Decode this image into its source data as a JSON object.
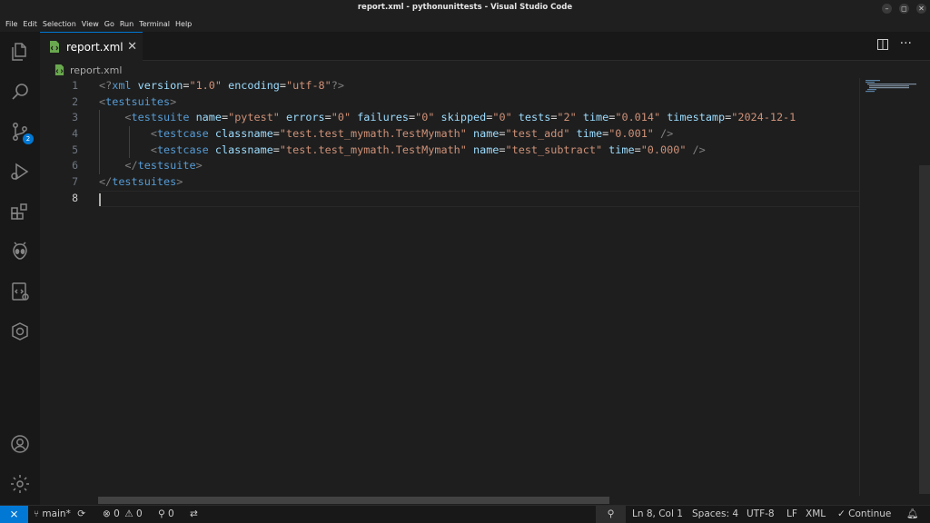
{
  "window": {
    "title": "report.xml - pythonunittests - Visual Studio Code",
    "controls": {
      "minimize": "–",
      "maximize": "◻",
      "close": "✕"
    }
  },
  "menu": [
    "File",
    "Edit",
    "Selection",
    "View",
    "Go",
    "Run",
    "Terminal",
    "Help"
  ],
  "activity_bar": {
    "icons": [
      "explorer-icon",
      "search-icon",
      "source-control-icon",
      "run-debug-icon",
      "extensions-icon",
      "testing-alien-icon",
      "remote-explorer-icon",
      "kubernetes-icon",
      "accounts-icon",
      "settings-gear-icon"
    ],
    "source_control_badge": "2"
  },
  "tab": {
    "label": "report.xml",
    "close": "✕"
  },
  "breadcrumb": {
    "file": "report.xml"
  },
  "editor": {
    "line_numbers": [
      "1",
      "2",
      "3",
      "4",
      "5",
      "6",
      "7",
      "8"
    ],
    "lines": [
      {
        "tokens": [
          {
            "c": "t-punc",
            "t": "<?"
          },
          {
            "c": "t-tag",
            "t": "xml"
          },
          {
            "c": "t-eq",
            "t": " "
          },
          {
            "c": "t-attr",
            "t": "version"
          },
          {
            "c": "t-eq",
            "t": "="
          },
          {
            "c": "t-str",
            "t": "\"1.0\""
          },
          {
            "c": "t-eq",
            "t": " "
          },
          {
            "c": "t-attr",
            "t": "encoding"
          },
          {
            "c": "t-eq",
            "t": "="
          },
          {
            "c": "t-str",
            "t": "\"utf-8\""
          },
          {
            "c": "t-punc",
            "t": "?>"
          }
        ]
      },
      {
        "tokens": [
          {
            "c": "t-punc",
            "t": "<"
          },
          {
            "c": "t-tag",
            "t": "testsuites"
          },
          {
            "c": "t-punc",
            "t": ">"
          }
        ]
      },
      {
        "tokens": [
          {
            "c": "t-eq",
            "t": "    "
          },
          {
            "c": "t-punc",
            "t": "<"
          },
          {
            "c": "t-tag",
            "t": "testsuite"
          },
          {
            "c": "t-eq",
            "t": " "
          },
          {
            "c": "t-attr",
            "t": "name"
          },
          {
            "c": "t-eq",
            "t": "="
          },
          {
            "c": "t-str",
            "t": "\"pytest\""
          },
          {
            "c": "t-eq",
            "t": " "
          },
          {
            "c": "t-attr",
            "t": "errors"
          },
          {
            "c": "t-eq",
            "t": "="
          },
          {
            "c": "t-str",
            "t": "\"0\""
          },
          {
            "c": "t-eq",
            "t": " "
          },
          {
            "c": "t-attr",
            "t": "failures"
          },
          {
            "c": "t-eq",
            "t": "="
          },
          {
            "c": "t-str",
            "t": "\"0\""
          },
          {
            "c": "t-eq",
            "t": " "
          },
          {
            "c": "t-attr",
            "t": "skipped"
          },
          {
            "c": "t-eq",
            "t": "="
          },
          {
            "c": "t-str",
            "t": "\"0\""
          },
          {
            "c": "t-eq",
            "t": " "
          },
          {
            "c": "t-attr",
            "t": "tests"
          },
          {
            "c": "t-eq",
            "t": "="
          },
          {
            "c": "t-str",
            "t": "\"2\""
          },
          {
            "c": "t-eq",
            "t": " "
          },
          {
            "c": "t-attr",
            "t": "time"
          },
          {
            "c": "t-eq",
            "t": "="
          },
          {
            "c": "t-str",
            "t": "\"0.014\""
          },
          {
            "c": "t-eq",
            "t": " "
          },
          {
            "c": "t-attr",
            "t": "timestamp"
          },
          {
            "c": "t-eq",
            "t": "="
          },
          {
            "c": "t-str",
            "t": "\"2024-12-1"
          }
        ]
      },
      {
        "tokens": [
          {
            "c": "t-eq",
            "t": "        "
          },
          {
            "c": "t-punc",
            "t": "<"
          },
          {
            "c": "t-tag",
            "t": "testcase"
          },
          {
            "c": "t-eq",
            "t": " "
          },
          {
            "c": "t-attr",
            "t": "classname"
          },
          {
            "c": "t-eq",
            "t": "="
          },
          {
            "c": "t-str",
            "t": "\"test.test_mymath.TestMymath\""
          },
          {
            "c": "t-eq",
            "t": " "
          },
          {
            "c": "t-attr",
            "t": "name"
          },
          {
            "c": "t-eq",
            "t": "="
          },
          {
            "c": "t-str",
            "t": "\"test_add\""
          },
          {
            "c": "t-eq",
            "t": " "
          },
          {
            "c": "t-attr",
            "t": "time"
          },
          {
            "c": "t-eq",
            "t": "="
          },
          {
            "c": "t-str",
            "t": "\"0.001\""
          },
          {
            "c": "t-eq",
            "t": " "
          },
          {
            "c": "t-punc",
            "t": "/>"
          }
        ]
      },
      {
        "tokens": [
          {
            "c": "t-eq",
            "t": "        "
          },
          {
            "c": "t-punc",
            "t": "<"
          },
          {
            "c": "t-tag",
            "t": "testcase"
          },
          {
            "c": "t-eq",
            "t": " "
          },
          {
            "c": "t-attr",
            "t": "classname"
          },
          {
            "c": "t-eq",
            "t": "="
          },
          {
            "c": "t-str",
            "t": "\"test.test_mymath.TestMymath\""
          },
          {
            "c": "t-eq",
            "t": " "
          },
          {
            "c": "t-attr",
            "t": "name"
          },
          {
            "c": "t-eq",
            "t": "="
          },
          {
            "c": "t-str",
            "t": "\"test_subtract\""
          },
          {
            "c": "t-eq",
            "t": " "
          },
          {
            "c": "t-attr",
            "t": "time"
          },
          {
            "c": "t-eq",
            "t": "="
          },
          {
            "c": "t-str",
            "t": "\"0.000\""
          },
          {
            "c": "t-eq",
            "t": " "
          },
          {
            "c": "t-punc",
            "t": "/>"
          }
        ]
      },
      {
        "tokens": [
          {
            "c": "t-eq",
            "t": "    "
          },
          {
            "c": "t-punc",
            "t": "</"
          },
          {
            "c": "t-tag",
            "t": "testsuite"
          },
          {
            "c": "t-punc",
            "t": ">"
          }
        ]
      },
      {
        "tokens": [
          {
            "c": "t-punc",
            "t": "</"
          },
          {
            "c": "t-tag",
            "t": "testsuites"
          },
          {
            "c": "t-punc",
            "t": ">"
          }
        ]
      },
      {
        "tokens": []
      }
    ]
  },
  "status_bar": {
    "remote_icon": "remote-icon",
    "branch": "main*",
    "errors": "0",
    "warnings": "0",
    "ports": "0",
    "cursor_position": "Ln 8, Col 1",
    "indentation": "Spaces: 4",
    "encoding": "UTF-8",
    "eol": "LF",
    "language": "XML",
    "continue": "Continue"
  },
  "colors": {
    "accent": "#0078d4",
    "tag": "#569cd6",
    "attribute": "#9cdcfe",
    "string": "#ce9178",
    "punctuation": "#808080"
  }
}
